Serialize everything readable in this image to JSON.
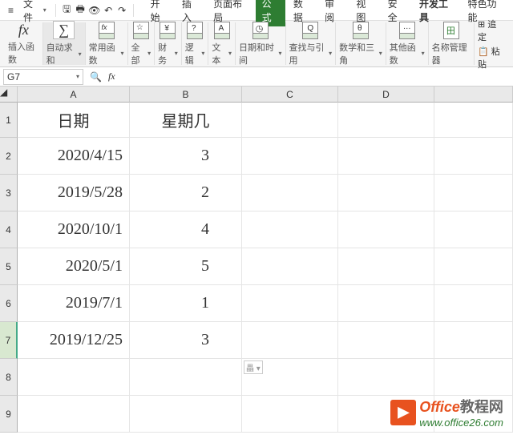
{
  "menu": {
    "file": "文件",
    "tabs": [
      "开始",
      "插入",
      "页面布局",
      "公式",
      "数据",
      "审阅",
      "视图",
      "安全",
      "开发工具",
      "特色功能"
    ],
    "active_tab_index": 3
  },
  "ribbon": {
    "insert_fn": "插入函数",
    "autosum": "自动求和",
    "common": "常用函数",
    "all": "全部",
    "finance": "财务",
    "logic": "逻辑",
    "text": "文本",
    "datetime": "日期和时间",
    "lookup": "查找与引用",
    "math": "数学和三角",
    "other": "其他函数",
    "name_mgr": "名称管理器",
    "trace": "追定",
    "paste": "粘贴"
  },
  "namebox": "G7",
  "columns": [
    "A",
    "B",
    "C",
    "D",
    ""
  ],
  "rows": [
    "1",
    "2",
    "3",
    "4",
    "5",
    "6",
    "7",
    "8",
    "9"
  ],
  "selected_row_index": 6,
  "chart_data": {
    "type": "table",
    "headers": [
      "日期",
      "星期几"
    ],
    "rows": [
      {
        "date": "2020/4/15",
        "weekday": "3"
      },
      {
        "date": "2019/5/28",
        "weekday": "2"
      },
      {
        "date": "2020/10/1",
        "weekday": "4"
      },
      {
        "date": "2020/5/1",
        "weekday": "5"
      },
      {
        "date": "2019/7/1",
        "weekday": "1"
      },
      {
        "date": "2019/12/25",
        "weekday": "3"
      }
    ]
  },
  "smart_tag": "畾",
  "watermark": {
    "brand": "Office",
    "suffix": "教程网",
    "url": "www.office26.com"
  }
}
